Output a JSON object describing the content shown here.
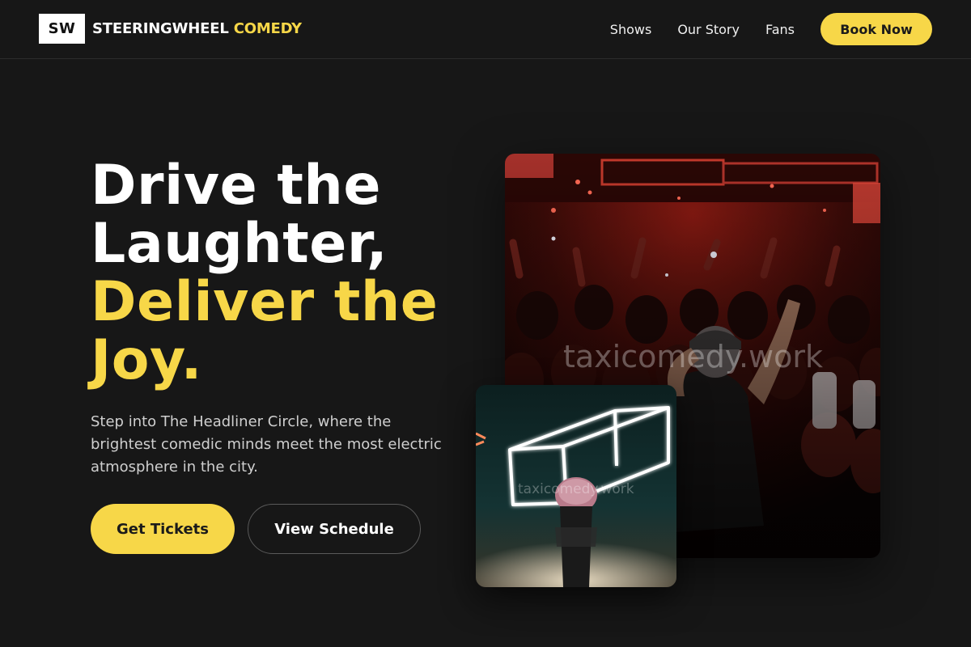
{
  "brand": {
    "mark": "SW",
    "name_part1": "STEERINGWHEEL",
    "name_part2": "COMEDY"
  },
  "nav": {
    "items": [
      {
        "label": "Shows"
      },
      {
        "label": "Our Story"
      },
      {
        "label": "Fans"
      }
    ],
    "cta_label": "Book Now"
  },
  "hero": {
    "title_line1": "Drive the",
    "title_line2": "Laughter,",
    "title_line3": "Deliver the",
    "title_line4": "Joy.",
    "subtitle": "Step into The Headliner Circle, where the brightest comedic minds meet the most electric atmosphere in the city.",
    "primary_button": "Get Tickets",
    "secondary_button": "View Schedule"
  },
  "images": {
    "main_watermark": "taxicomedy.work",
    "small_watermark": "taxicomedy.work"
  },
  "colors": {
    "background": "#171717",
    "accent": "#f7d748",
    "text": "#ffffff",
    "muted_text": "#cfcfcf"
  }
}
